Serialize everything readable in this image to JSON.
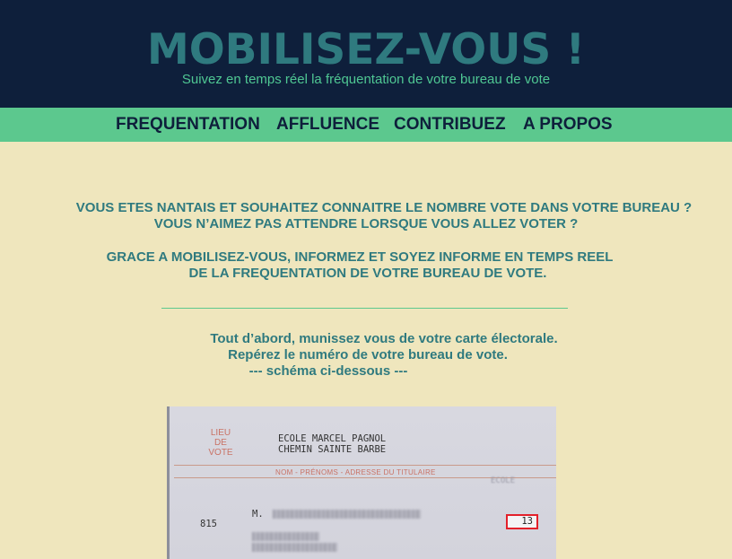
{
  "header": {
    "title": "MOBILISEZ-VOUS !",
    "subtitle": "Suivez en temps réel la fréquentation de votre bureau de vote"
  },
  "nav": {
    "items": [
      {
        "label": "FREQUENTATION"
      },
      {
        "label": "AFFLUENCE"
      },
      {
        "label": "CONTRIBUEZ"
      },
      {
        "label": "A PROPOS"
      }
    ]
  },
  "intro": {
    "line1": "VOUS ETES NANTAIS ET SOUHAITEZ CONNAITRE LE NOMBRE VOTE DANS VOTRE BUREAU ?",
    "line2": "VOUS N’AIMEZ PAS ATTENDRE LORSQUE VOUS ALLEZ VOTER ?",
    "line3": "GRACE A MOBILISEZ-VOUS, INFORMEZ ET SOYEZ INFORME EN TEMPS REEL",
    "line4": "DE LA FREQUENTATION DE VOTRE BUREAU DE VOTE."
  },
  "howto": {
    "line1": "Tout d’abord, munissez vous de votre carte électorale.",
    "line2": "Repérez le numéro de votre bureau de vote.",
    "line3": "--- schéma ci-dessous ---"
  },
  "card": {
    "lieu_line1": "LIEU",
    "lieu_line2": "DE",
    "lieu_line3": "VOTE",
    "address_line1": "ECOLE MARCEL PAGNOL",
    "address_line2": "CHEMIN SAINTE BARBE",
    "holder_label": "NOM - PRÉNOMS - ADRESSE DU TITULAIRE",
    "ecole_tag": "ECOLE",
    "elector_number": "815",
    "civility": "M.",
    "bureau_number": "13"
  },
  "colors": {
    "header_bg": "#0e1f3b",
    "title": "#2f7a7f",
    "subtitle": "#4fc793",
    "nav_bg": "#5cc88e",
    "page_bg": "#efe6bd",
    "highlight_box": "#e3202a"
  }
}
